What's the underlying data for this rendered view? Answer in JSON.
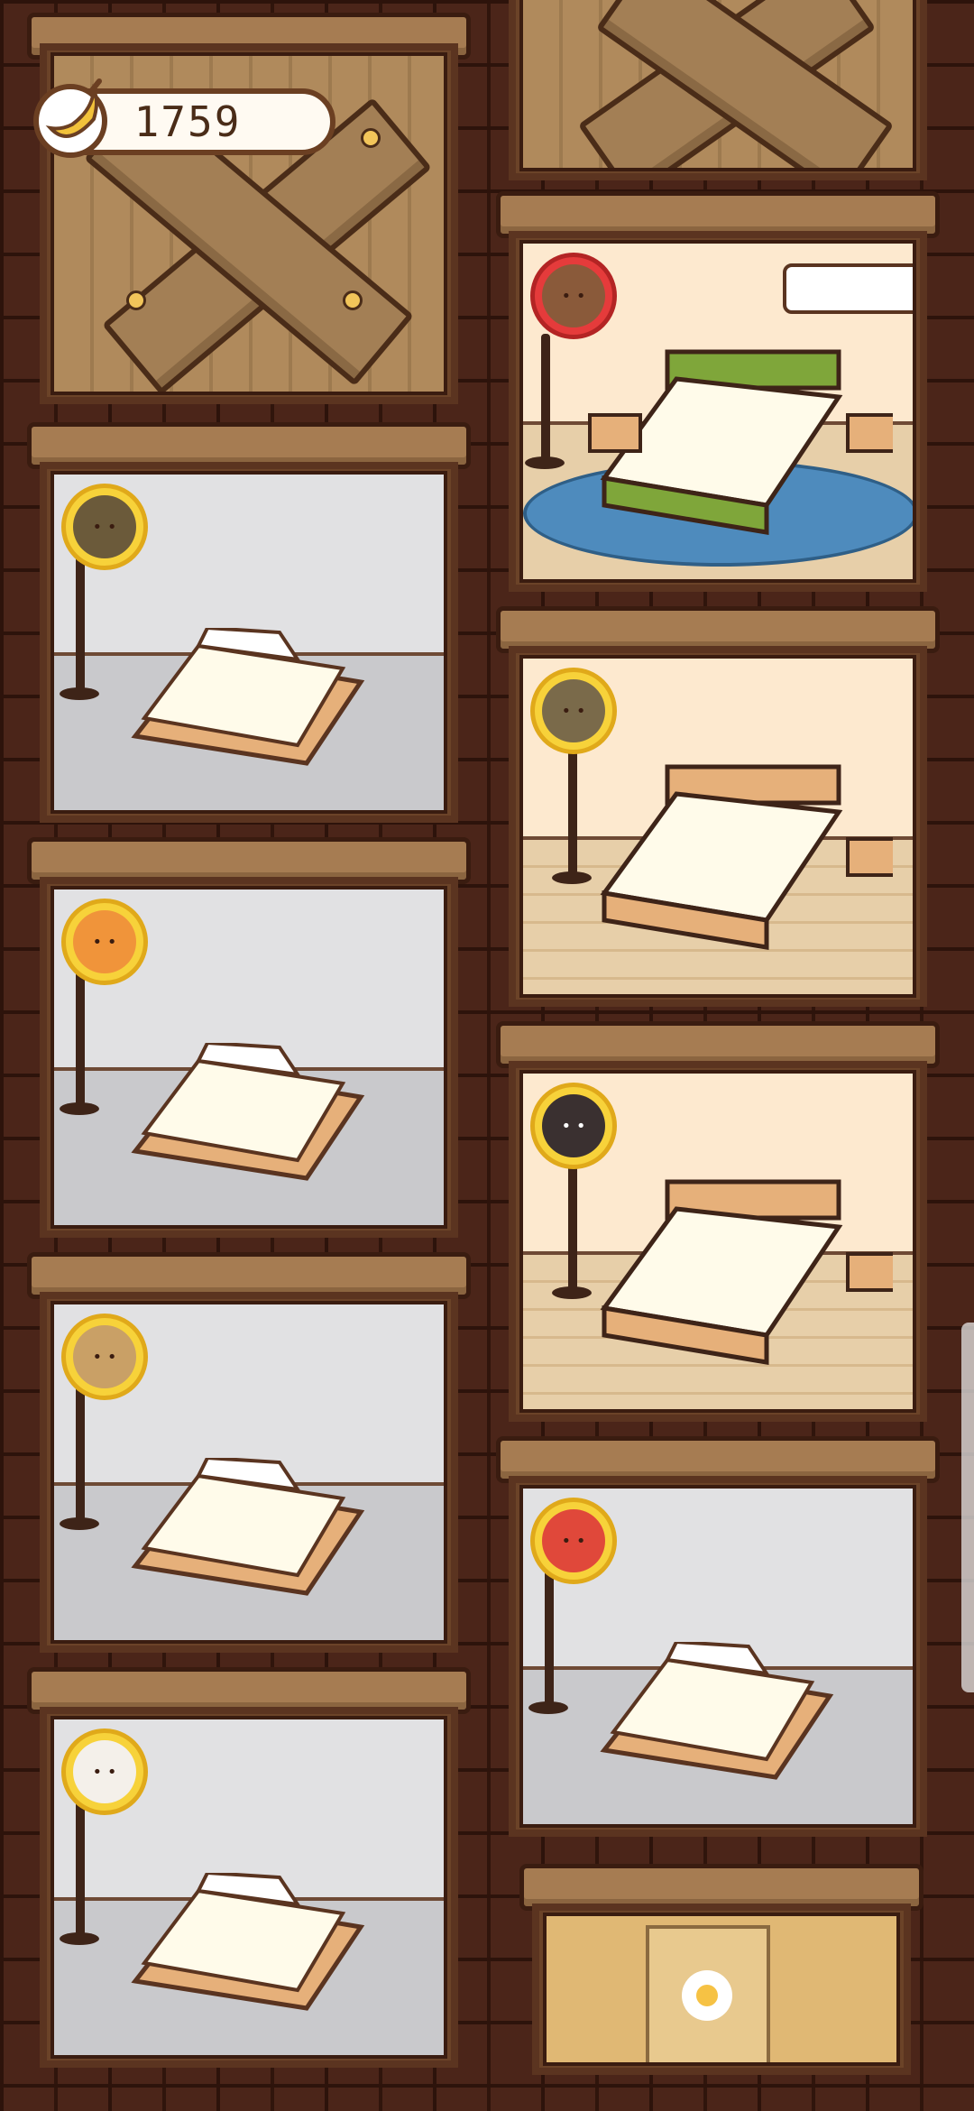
{
  "currency": {
    "icon": "banana-icon",
    "value": "1759"
  },
  "rooms": {
    "left": [
      {
        "name": "boarded-room",
        "type": "locked"
      },
      {
        "name": "room-hat-monster",
        "type": "basic",
        "resident_icon": "hat-monster-icon"
      },
      {
        "name": "room-orange-monster",
        "type": "basic",
        "resident_icon": "orange-monster-icon"
      },
      {
        "name": "room-lion-monster",
        "type": "basic",
        "resident_icon": "lion-monster-icon"
      },
      {
        "name": "room-bunny-monster",
        "type": "basic",
        "resident_icon": "bunny-monster-icon"
      }
    ],
    "right": [
      {
        "name": "boarded-room",
        "type": "locked"
      },
      {
        "name": "room-onion-monster",
        "type": "deluxe",
        "resident_icon": "onion-monster-icon"
      },
      {
        "name": "room-robot-monster",
        "type": "wood",
        "resident_icon": "robot-monster-icon"
      },
      {
        "name": "room-dark-monster",
        "type": "wood",
        "resident_icon": "dark-monster-icon"
      },
      {
        "name": "room-burger-monster",
        "type": "basic",
        "resident_icon": "burger-monster-icon"
      },
      {
        "name": "kitchen-room",
        "type": "door"
      }
    ]
  },
  "colors": {
    "wall": "#4b2519",
    "badge": "#f7d23a"
  }
}
